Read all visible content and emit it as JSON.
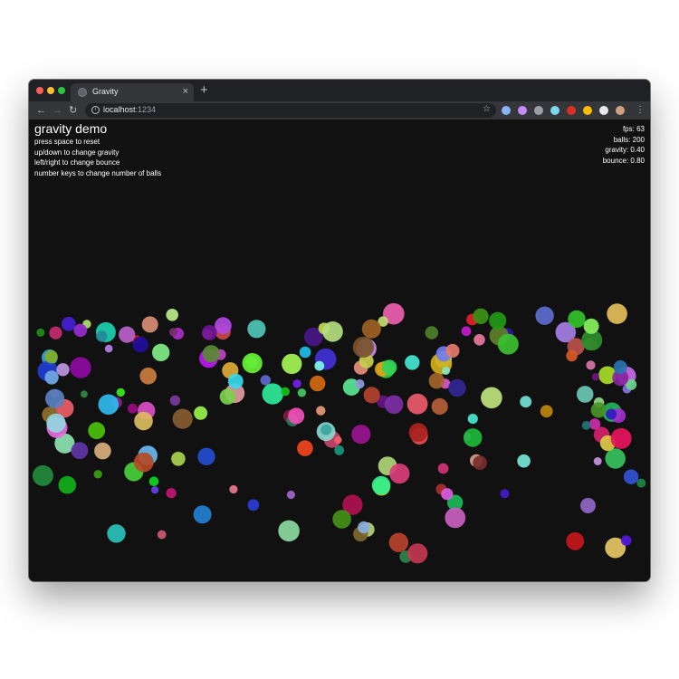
{
  "browser": {
    "tab_title": "Gravity",
    "tab_close": "×",
    "new_tab": "+",
    "url_host": "localhost",
    "url_port": ":1234",
    "nav_back": "←",
    "nav_forward": "→",
    "nav_reload": "↻",
    "star": "☆",
    "menu": "⋮",
    "extension_colors": [
      "#8ab4f8",
      "#c58af9",
      "#9aa0a6",
      "#78d9ec",
      "#d93025",
      "#fbbc04",
      "#e8eaed",
      "#d0a080"
    ]
  },
  "demo": {
    "title": "gravity demo",
    "instructions": [
      "press space to reset",
      "up/down to change gravity",
      "left/right to change bounce",
      "number keys to change number of balls"
    ],
    "stats": {
      "fps_label": "fps:",
      "fps": "63",
      "balls_label": "balls:",
      "balls": "200",
      "gravity_label": "gravity:",
      "gravity": "0.40",
      "bounce_label": "bounce:",
      "bounce": "0.80"
    }
  },
  "colors": {
    "background": "#111111",
    "chrome_dark": "#202124",
    "chrome_light": "#35363a",
    "text": "#ffffff"
  }
}
